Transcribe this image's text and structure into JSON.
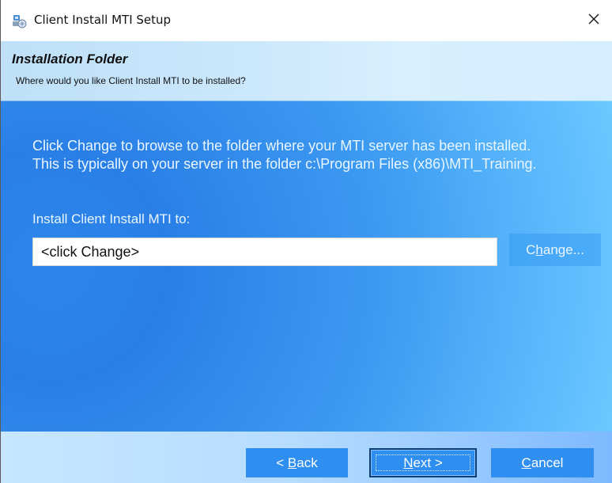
{
  "titlebar": {
    "title": "Client Install MTI Setup",
    "app_icon": "installer-icon",
    "close_icon": "close-icon"
  },
  "header": {
    "title": "Installation Folder",
    "subtitle": "Where would you like Client Install MTI to be installed?"
  },
  "main": {
    "body_line_1": "Click Change to browse to the folder where your MTI server has been installed.",
    "body_line_2": "This is typically on your server in the folder c:\\Program Files (x86)\\MTI_Training.",
    "install_label": "Install Client Install MTI to:",
    "path_value": "<click Change>"
  },
  "buttons": {
    "change": {
      "prefix": "C",
      "mnemonic": "h",
      "suffix": "ange..."
    },
    "back": {
      "prefix": "< ",
      "mnemonic": "B",
      "suffix": "ack"
    },
    "next": {
      "mnemonic": "N",
      "suffix": "ext >"
    },
    "cancel": {
      "mnemonic": "C",
      "suffix": "ancel"
    }
  },
  "colors": {
    "header_band": "#CFEAFF",
    "content_dark_blue": "#2A7FE6",
    "content_light_blue": "#6BC8FF",
    "button_blue": "#2F8FF1",
    "footer_blue": "#B6DCFF",
    "next_border": "#0D3F77"
  }
}
